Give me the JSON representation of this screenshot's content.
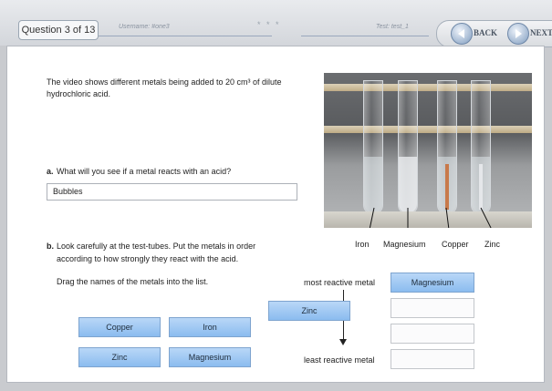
{
  "header": {
    "question_counter": "Question 3 of 13",
    "username_label": "Username: #one3",
    "dots": "* * *",
    "test_label": "Test: test_1",
    "back_label": "BACK",
    "next_label": "NEXT"
  },
  "intro": {
    "text": "The video shows different metals being added to 20 cm³ of dilute hydrochloric acid."
  },
  "part_a": {
    "letter": "a.",
    "question": "What will you see if a metal reacts with an acid?",
    "answer_value": "Bubbles"
  },
  "part_b": {
    "letter": "b.",
    "line1": "Look carefully at the test-tubes.  Put the metals in order",
    "line2": "according to how strongly they react with the acid.",
    "instruction": "Drag the names of the metals into the list."
  },
  "photo": {
    "labels": [
      "Iron",
      "Magnesium",
      "Copper",
      "Zinc"
    ]
  },
  "ranking": {
    "top_label": "most reactive metal",
    "bottom_label": "least reactive metal",
    "slots": [
      "Magnesium",
      "",
      "",
      ""
    ]
  },
  "tiles": {
    "dragging": "Zinc",
    "source": [
      "Copper",
      "Iron",
      "Zinc",
      "Magnesium"
    ]
  },
  "colors": {
    "tile": "#9cc7f2",
    "nav_button": "#7f9cbf"
  }
}
